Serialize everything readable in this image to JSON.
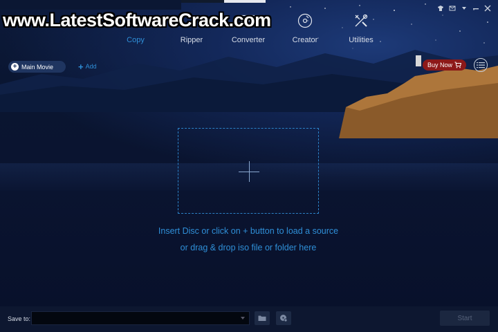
{
  "watermark": "www.LatestSoftwareCrack.com",
  "nav": {
    "tabs": [
      {
        "label": "Copy",
        "icon": "copy-icon",
        "active": true
      },
      {
        "label": "Ripper",
        "icon": "ripper-icon",
        "active": false
      },
      {
        "label": "Converter",
        "icon": "film-icon",
        "active": false
      },
      {
        "label": "Creator",
        "icon": "disc-icon",
        "active": false
      },
      {
        "label": "Utilities",
        "icon": "tools-icon",
        "active": false
      }
    ]
  },
  "toolbar": {
    "main_movie_label": "Main Movie",
    "add_label": "Add",
    "buy_now_label": "Buy Now"
  },
  "drop_zone": {
    "hint_line1": "Insert Disc or click on + button to load a source",
    "hint_line2": "or drag & drop iso file or folder here"
  },
  "footer": {
    "save_to_label": "Save to:",
    "save_to_value": "",
    "start_label": "Start"
  },
  "colors": {
    "accent": "#2f8fd8",
    "buy_now": "#8d1919",
    "background": "#0a1430"
  }
}
